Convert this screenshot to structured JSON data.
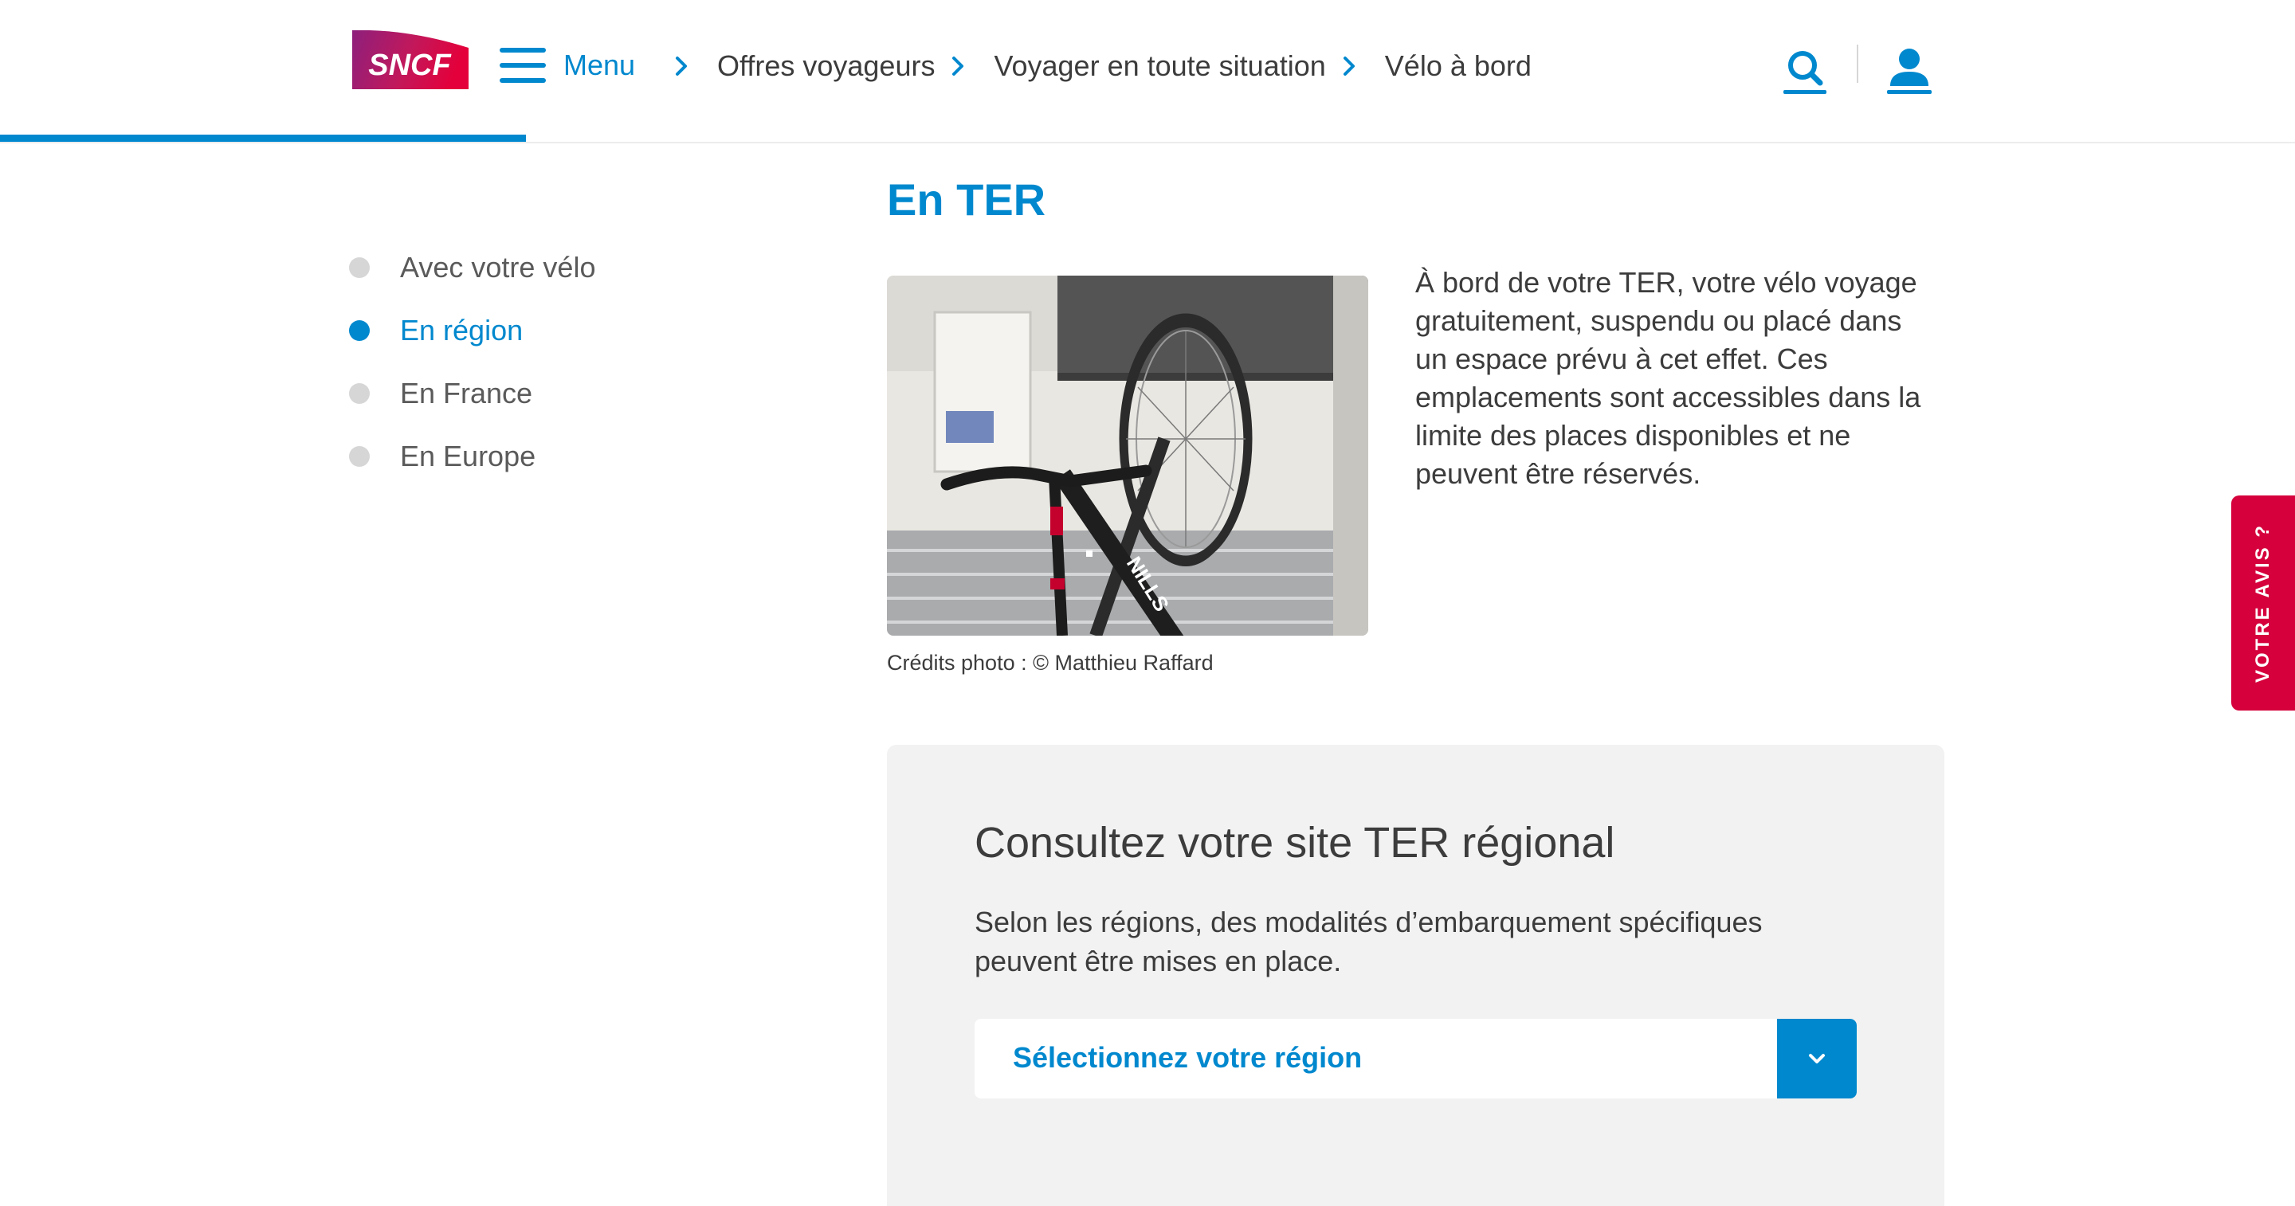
{
  "colors": {
    "accent": "#0088ce",
    "feedback": "#d5003c",
    "panel_bg": "#f2f2f2"
  },
  "header": {
    "logo_text": "SNCF",
    "menu_label": "Menu",
    "breadcrumb": [
      "Offres voyageurs",
      "Voyager en toute situation",
      "Vélo à bord"
    ],
    "icons": [
      "search-icon",
      "account-icon"
    ]
  },
  "sidenav": {
    "items": [
      {
        "label": "Avec votre vélo",
        "active": false
      },
      {
        "label": "En région",
        "active": true
      },
      {
        "label": "En France",
        "active": false
      },
      {
        "label": "En Europe",
        "active": false
      }
    ]
  },
  "main": {
    "title": "En TER",
    "photo_caption": "Crédits photo : © Matthieu Raffard",
    "photo_bike_text": "NILLS",
    "intro": "À bord de votre TER, votre vélo voyage gratuitement, suspendu ou placé dans un espace prévu à cet effet. Ces emplacements sont accessibles dans la limite des places disponibles et ne peuvent être réservés."
  },
  "region_panel": {
    "title": "Consultez votre site TER régional",
    "text": "Selon les régions, des modalités d’embarquement spécifiques peuvent être mises en place.",
    "select_label": "Sélectionnez votre région"
  },
  "feedback_tab": {
    "label": "VOTRE AVIS ?"
  }
}
